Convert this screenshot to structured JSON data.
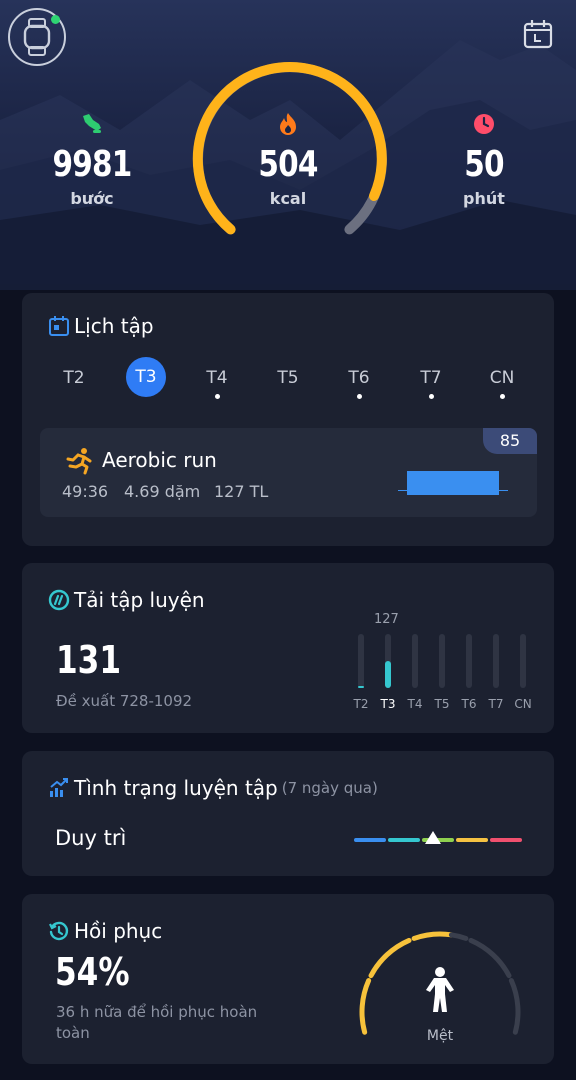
{
  "summary": {
    "steps": {
      "value": "9981",
      "unit": "bước"
    },
    "calories": {
      "value": "504",
      "unit": "kcal"
    },
    "minutes": {
      "value": "50",
      "unit": "phút"
    },
    "colors": {
      "steps": "#2ecc71",
      "calories": "#ff7a1a",
      "minutes": "#ff4d6a",
      "ring": "#ffb31a",
      "ring_remaining": "#6c7080"
    }
  },
  "schedule": {
    "title": "Lịch tập",
    "days": [
      {
        "label": "T2",
        "selected": false,
        "has_workout": false
      },
      {
        "label": "T3",
        "selected": true,
        "has_workout": false
      },
      {
        "label": "T4",
        "selected": false,
        "has_workout": true
      },
      {
        "label": "T5",
        "selected": false,
        "has_workout": false
      },
      {
        "label": "T6",
        "selected": false,
        "has_workout": true
      },
      {
        "label": "T7",
        "selected": false,
        "has_workout": true
      },
      {
        "label": "CN",
        "selected": false,
        "has_workout": true
      }
    ],
    "workout": {
      "name": "Aerobic run",
      "duration": "49:36",
      "distance": "4.69 dặm",
      "load": "127 TL",
      "score": "85"
    }
  },
  "training_load": {
    "title": "Tải tập luyện",
    "value": "131",
    "recommendation": "Đề xuất 728-1092",
    "peak_label": "127",
    "bars": [
      {
        "day": "T2",
        "level": 0.04,
        "selected": false
      },
      {
        "day": "T3",
        "level": 0.5,
        "selected": true
      },
      {
        "day": "T4",
        "level": 0,
        "selected": false
      },
      {
        "day": "T5",
        "level": 0,
        "selected": false
      },
      {
        "day": "T6",
        "level": 0,
        "selected": false
      },
      {
        "day": "T7",
        "level": 0,
        "selected": false
      },
      {
        "day": "CN",
        "level": 0,
        "selected": false
      }
    ]
  },
  "training_status": {
    "title": "Tình trạng luyện tập",
    "period": "(7 ngày qua)",
    "value": "Duy trì",
    "scale_colors": [
      "#3a8ff0",
      "#35c7cf",
      "#8fd14f",
      "#f5c242",
      "#f0506e"
    ],
    "marker_position": 0.47
  },
  "recovery": {
    "title": "Hồi phục",
    "value": "54%",
    "description": "36 h nữa để hồi phục hoàn toàn",
    "state": "Mệt",
    "level": 0.54,
    "color": "#f7c23b"
  }
}
